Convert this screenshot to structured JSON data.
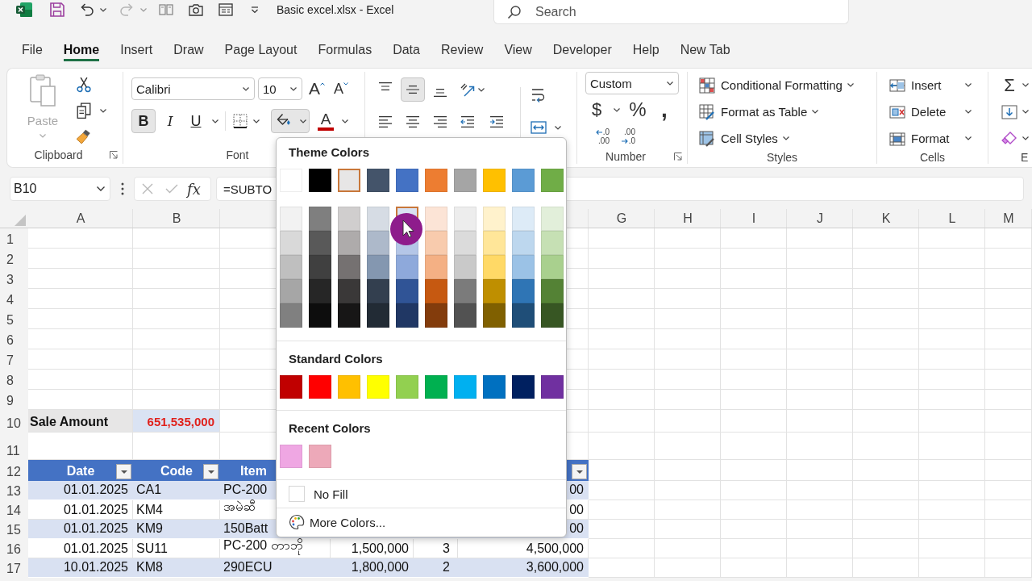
{
  "title_bar": {
    "title": "Basic excel.xlsx - Excel",
    "undo": {
      "disabled": false
    },
    "redo": {
      "disabled": true
    },
    "search": {
      "placeholder": "Search"
    }
  },
  "tabs": [
    {
      "label": "File",
      "selected": false
    },
    {
      "label": "Home",
      "selected": true
    },
    {
      "label": "Insert",
      "selected": false
    },
    {
      "label": "Draw",
      "selected": false
    },
    {
      "label": "Page Layout",
      "selected": false
    },
    {
      "label": "Formulas",
      "selected": false
    },
    {
      "label": "Data",
      "selected": false
    },
    {
      "label": "Review",
      "selected": false
    },
    {
      "label": "View",
      "selected": false
    },
    {
      "label": "Developer",
      "selected": false
    },
    {
      "label": "Help",
      "selected": false
    },
    {
      "label": "New Tab",
      "selected": false
    }
  ],
  "ribbon": {
    "clipboard": {
      "label": "Clipboard",
      "paste": {
        "label": "Paste",
        "disabled": true
      }
    },
    "font": {
      "label": "Font",
      "font_name": "Calibri",
      "font_size": "10",
      "grow_font": "A",
      "shrink_font": "A",
      "styles": [
        {
          "label": "B",
          "pressed": true
        },
        {
          "label": "I",
          "pressed": false
        },
        {
          "label": "U",
          "pressed": false
        }
      ],
      "fill_color": {
        "expanded": true
      },
      "font_color": {
        "label": "A"
      }
    },
    "alignment": {
      "vertical": [
        {
          "pressed": false
        },
        {
          "pressed": true
        },
        {
          "pressed": false
        }
      ],
      "horizontal": [
        {
          "pressed": false
        },
        {
          "pressed": false
        },
        {
          "pressed": false
        }
      ]
    },
    "number": {
      "label": "Number",
      "format": "Custom",
      "symbols": [
        "$",
        "%",
        ","
      ],
      "decimals": [
        {
          "top": ".0",
          "bottom": ".00"
        },
        {
          "top": ".00",
          "bottom": ".0"
        }
      ]
    },
    "styles": {
      "label": "Styles",
      "items": [
        "Conditional Formatting",
        "Format as Table",
        "Cell Styles"
      ]
    },
    "cells": {
      "label": "Cells",
      "items": [
        "Insert",
        "Delete",
        "Format"
      ]
    },
    "editing": {
      "label": "E",
      "autosum": "Σ"
    }
  },
  "formula_bar": {
    "name_box": "B10",
    "editing": false,
    "function_button": "fx",
    "formula": "=SUBTO"
  },
  "sheet": {
    "column_headers": [
      "A",
      "B",
      "G",
      "H",
      "I",
      "J",
      "K",
      "L",
      "M"
    ],
    "row_headers": [
      "1",
      "2",
      "3",
      "4",
      "5",
      "6",
      "7",
      "8",
      "9",
      "10",
      "11",
      "12",
      "13",
      "14",
      "15",
      "16",
      "17"
    ],
    "summary": {
      "label": "Sale Amount",
      "value": "651,535,000"
    },
    "table": {
      "header": [
        "Date",
        "Code",
        "Item"
      ],
      "rows": [
        {
          "date": "01.01.2025",
          "code": "CA1",
          "item": "PC-200",
          "column_6": "00"
        },
        {
          "date": "01.01.2025",
          "code": "KM4",
          "item": "အမဲဆီ",
          "column_6": "00"
        },
        {
          "date": "01.01.2025",
          "code": "KM9",
          "item": "150Batt",
          "column_6": "00"
        },
        {
          "date": "01.01.2025",
          "code": "SU11",
          "item": "PC-200 တာဘို",
          "column_4": "1,500,000",
          "column_5": "3",
          "column_6": "4,500,000"
        },
        {
          "date": "10.01.2025",
          "code": "KM8",
          "item": "290ECU",
          "column_4": "1,800,000",
          "column_5": "2",
          "column_6": "3,600,000"
        }
      ]
    }
  },
  "fill_menu": {
    "theme": {
      "title": "Theme Colors",
      "base": [
        {
          "color": "#ffffff",
          "selected": false
        },
        {
          "color": "#000000",
          "selected": false
        },
        {
          "color": "#e7e6e6",
          "selected": true
        },
        {
          "color": "#44546a",
          "selected": false
        },
        {
          "color": "#4472c4",
          "selected": false
        },
        {
          "color": "#ed7d31",
          "selected": false
        },
        {
          "color": "#a5a5a5",
          "selected": false
        },
        {
          "color": "#ffc000",
          "selected": false
        },
        {
          "color": "#5b9bd5",
          "selected": false
        },
        {
          "color": "#70ad47",
          "selected": false
        }
      ],
      "tint_rows": [
        {
          "swatches": [
            {
              "color": "#f2f2f2",
              "selected": false
            },
            {
              "color": "#7f7f7f",
              "selected": false
            },
            {
              "color": "#d0cece",
              "selected": false
            },
            {
              "color": "#d6dce4",
              "selected": false
            },
            {
              "color": "#d9e1f2",
              "selected": true
            },
            {
              "color": "#fce4d6",
              "selected": false
            },
            {
              "color": "#ededed",
              "selected": false
            },
            {
              "color": "#fff2cc",
              "selected": false
            },
            {
              "color": "#ddebf7",
              "selected": false
            },
            {
              "color": "#e2efda",
              "selected": false
            }
          ]
        },
        {
          "swatches": [
            {
              "color": "#d9d9d9",
              "selected": false
            },
            {
              "color": "#595959",
              "selected": false
            },
            {
              "color": "#aeabab",
              "selected": false
            },
            {
              "color": "#adb9ca",
              "selected": false
            },
            {
              "color": "#b4c6e7",
              "selected": false
            },
            {
              "color": "#f8cbad",
              "selected": false
            },
            {
              "color": "#dbdbdb",
              "selected": false
            },
            {
              "color": "#ffe699",
              "selected": false
            },
            {
              "color": "#bdd7ee",
              "selected": false
            },
            {
              "color": "#c6e0b4",
              "selected": false
            }
          ]
        },
        {
          "swatches": [
            {
              "color": "#bfbfbf",
              "selected": false
            },
            {
              "color": "#404040",
              "selected": false
            },
            {
              "color": "#757171",
              "selected": false
            },
            {
              "color": "#8497b0",
              "selected": false
            },
            {
              "color": "#8ea9db",
              "selected": false
            },
            {
              "color": "#f4b084",
              "selected": false
            },
            {
              "color": "#c9c9c9",
              "selected": false
            },
            {
              "color": "#ffd966",
              "selected": false
            },
            {
              "color": "#9bc2e6",
              "selected": false
            },
            {
              "color": "#a9d08e",
              "selected": false
            }
          ]
        },
        {
          "swatches": [
            {
              "color": "#a6a6a6",
              "selected": false
            },
            {
              "color": "#262626",
              "selected": false
            },
            {
              "color": "#3a3838",
              "selected": false
            },
            {
              "color": "#333f4f",
              "selected": false
            },
            {
              "color": "#305496",
              "selected": false
            },
            {
              "color": "#c65911",
              "selected": false
            },
            {
              "color": "#7b7b7b",
              "selected": false
            },
            {
              "color": "#bf8f00",
              "selected": false
            },
            {
              "color": "#2f75b5",
              "selected": false
            },
            {
              "color": "#548235",
              "selected": false
            }
          ]
        },
        {
          "swatches": [
            {
              "color": "#808080",
              "selected": false
            },
            {
              "color": "#0d0d0d",
              "selected": false
            },
            {
              "color": "#171616",
              "selected": false
            },
            {
              "color": "#222b35",
              "selected": false
            },
            {
              "color": "#203764",
              "selected": false
            },
            {
              "color": "#833c0c",
              "selected": false
            },
            {
              "color": "#525252",
              "selected": false
            },
            {
              "color": "#806000",
              "selected": false
            },
            {
              "color": "#1f4e78",
              "selected": false
            },
            {
              "color": "#375623",
              "selected": false
            }
          ]
        }
      ]
    },
    "standard": {
      "title": "Standard Colors",
      "swatches": [
        {
          "color": "#c00000",
          "selected": false
        },
        {
          "color": "#ff0000",
          "selected": false
        },
        {
          "color": "#ffc000",
          "selected": false
        },
        {
          "color": "#ffff00",
          "selected": false
        },
        {
          "color": "#92d050",
          "selected": false
        },
        {
          "color": "#00b050",
          "selected": false
        },
        {
          "color": "#00b0f0",
          "selected": false
        },
        {
          "color": "#0070c0",
          "selected": false
        },
        {
          "color": "#002060",
          "selected": false
        },
        {
          "color": "#7030a0",
          "selected": false
        }
      ]
    },
    "recent": {
      "title": "Recent Colors",
      "swatches": [
        {
          "color": "#efa7e3",
          "selected": false
        },
        {
          "color": "#eda9b9",
          "selected": false
        }
      ]
    },
    "no_fill": "No Fill",
    "more_colors": "More Colors..."
  }
}
